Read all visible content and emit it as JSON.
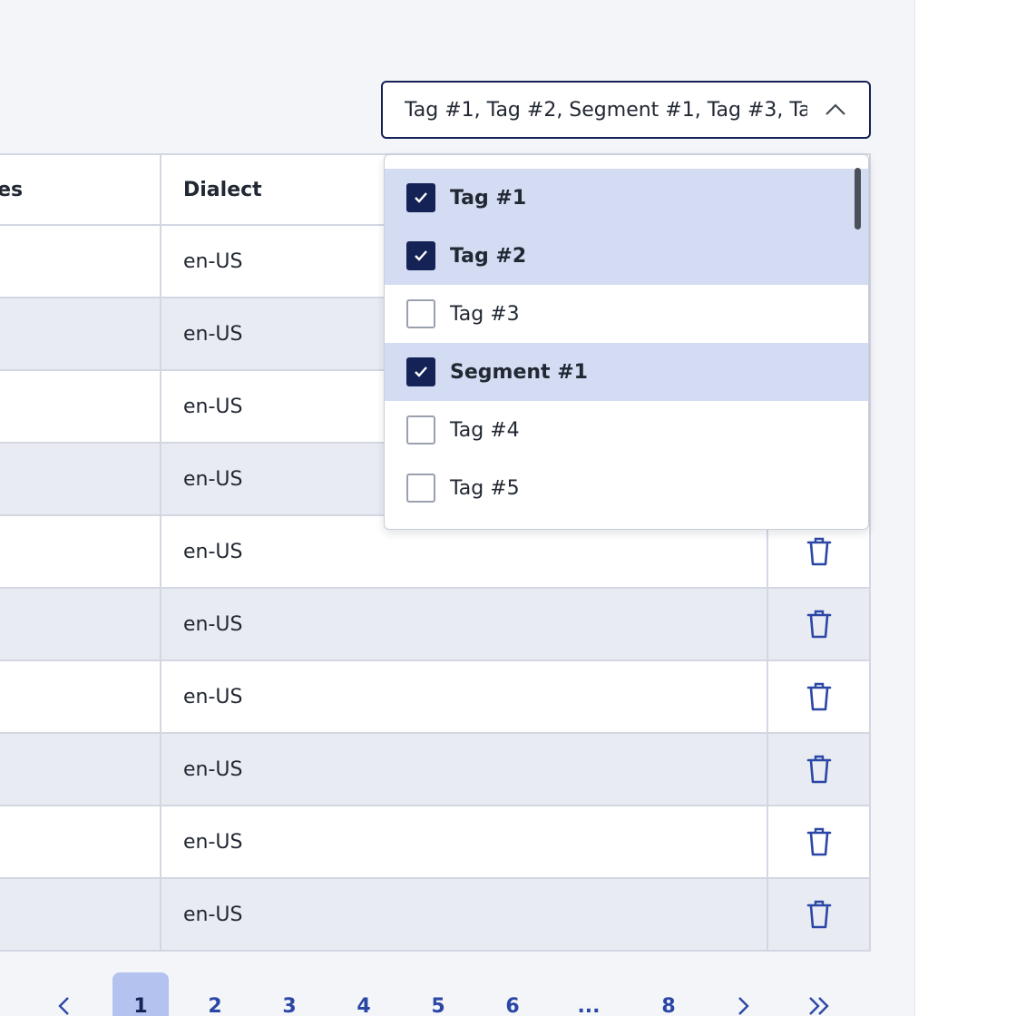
{
  "filter": {
    "value": "Tag #1, Tag #2, Segment #1, Tag #3, Ta...",
    "icon": "chevron-up-icon"
  },
  "table": {
    "columns": [
      "ses",
      "Dialect",
      ""
    ],
    "rows": [
      {
        "dialect": "en-US"
      },
      {
        "dialect": "en-US"
      },
      {
        "dialect": "en-US"
      },
      {
        "dialect": "en-US"
      },
      {
        "dialect": "en-US"
      },
      {
        "dialect": "en-US"
      },
      {
        "dialect": "en-US"
      },
      {
        "dialect": "en-US"
      },
      {
        "dialect": "en-US"
      },
      {
        "dialect": "en-US"
      }
    ],
    "row_action_icon": "trash-icon"
  },
  "dropdown": {
    "options": [
      {
        "label": "Tag #1",
        "checked": true
      },
      {
        "label": "Tag #2",
        "checked": true
      },
      {
        "label": "Tag #3",
        "checked": false
      },
      {
        "label": "Segment #1",
        "checked": true
      },
      {
        "label": "Tag #4",
        "checked": false
      },
      {
        "label": "Tag #5",
        "checked": false
      }
    ]
  },
  "pagination": {
    "prev": "‹",
    "pages": [
      "1",
      "2",
      "3",
      "4",
      "5",
      "6",
      "...",
      "8"
    ],
    "current": "1",
    "next": "›",
    "last": "»"
  },
  "colors": {
    "accent": "#152255",
    "selected_row": "#d3dcf3",
    "link": "#2b47a5"
  }
}
